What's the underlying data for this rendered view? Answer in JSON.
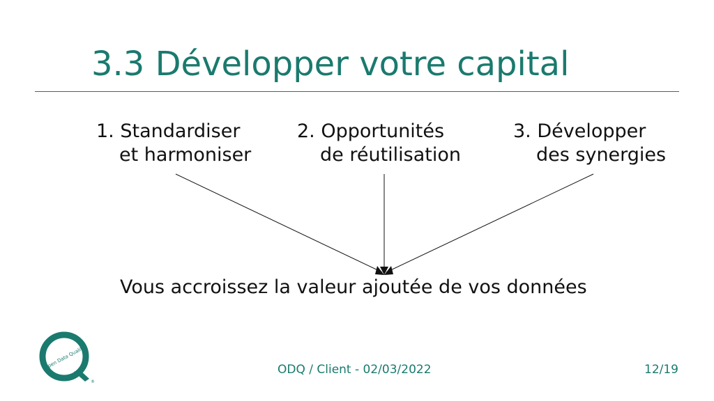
{
  "slide": {
    "title": "3.3 Développer votre capital",
    "items": [
      {
        "line1": "1. Standardiser",
        "line2": "et harmoniser"
      },
      {
        "line1": "2. Opportunités",
        "line2": "de réutilisation"
      },
      {
        "line1": "3. Développer",
        "line2": "des synergies"
      }
    ],
    "result": "Vous accroissez la valeur ajoutée de vos données"
  },
  "logo": {
    "text": "Open Data Quality",
    "registered": "®"
  },
  "footer": {
    "center": "ODQ / Client - 02/03/2022",
    "page": "12/19"
  },
  "colors": {
    "accent": "#1a7a6e",
    "text": "#111111"
  }
}
